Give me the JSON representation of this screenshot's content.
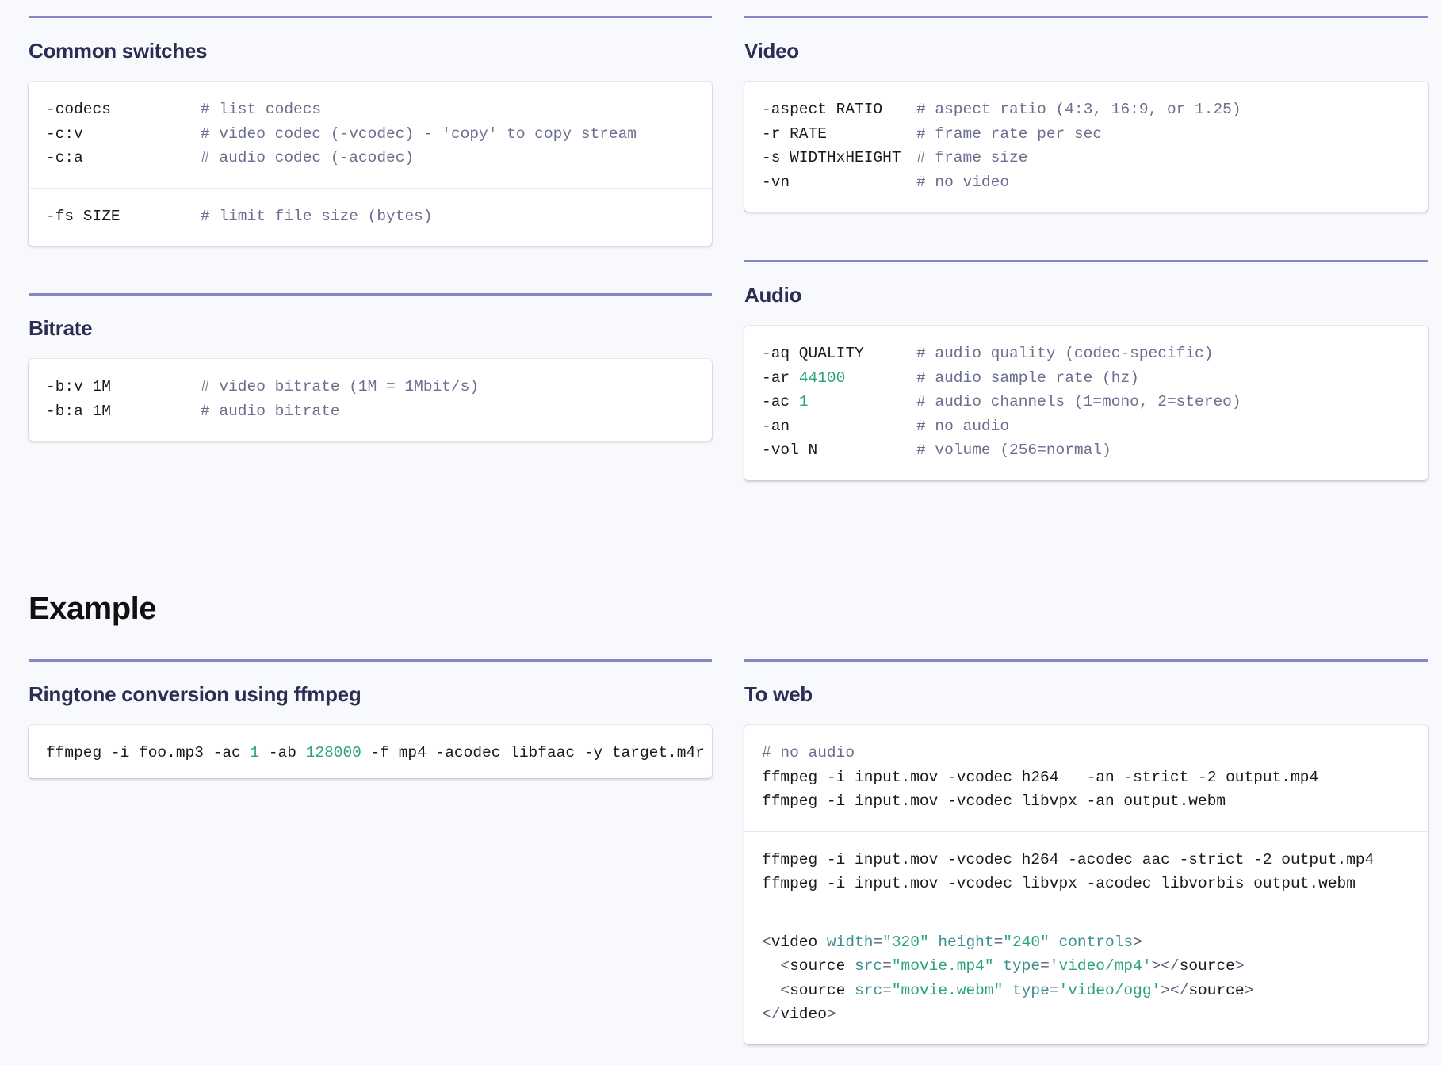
{
  "common_switches": {
    "title": "Common switches",
    "blocks": [
      [
        {
          "opt": "-codecs",
          "cmt": "# list codecs"
        },
        {
          "opt": "-c:v",
          "cmt": "# video codec (-vcodec) - 'copy' to copy stream"
        },
        {
          "opt": "-c:a",
          "cmt": "# audio codec (-acodec)"
        }
      ],
      [
        {
          "opt": "-fs SIZE",
          "cmt": "# limit file size (bytes)"
        }
      ]
    ]
  },
  "bitrate": {
    "title": "Bitrate",
    "lines": [
      {
        "opt": "-b:v 1M",
        "cmt": "# video bitrate (1M = 1Mbit/s)"
      },
      {
        "opt": "-b:a 1M",
        "cmt": "# audio bitrate"
      }
    ]
  },
  "video": {
    "title": "Video",
    "lines": [
      {
        "opt": "-aspect RATIO",
        "cmt": "# aspect ratio (4:3, 16:9, or 1.25)"
      },
      {
        "opt": "-r RATE",
        "cmt": "# frame rate per sec"
      },
      {
        "opt": "-s WIDTHxHEIGHT",
        "cmt": "# frame size"
      },
      {
        "opt": "-vn",
        "cmt": "# no video"
      }
    ]
  },
  "audio": {
    "title": "Audio",
    "lines": [
      {
        "opt": "-aq QUALITY",
        "num": "",
        "cmt": "# audio quality (codec-specific)"
      },
      {
        "opt": "-ar ",
        "num": "44100",
        "cmt": "# audio sample rate (hz)"
      },
      {
        "opt": "-ac ",
        "num": "1",
        "cmt": "# audio channels (1=mono, 2=stereo)"
      },
      {
        "opt": "-an",
        "num": "",
        "cmt": "# no audio"
      },
      {
        "opt": "-vol N",
        "num": "",
        "cmt": "# volume (256=normal)"
      }
    ]
  },
  "example": {
    "heading": "Example",
    "ringtone": {
      "title": "Ringtone conversion using ffmpeg",
      "parts": {
        "p1": "ffmpeg -i foo.mp3 -ac ",
        "n1": "1",
        "p2": " -ab ",
        "n2": "128000",
        "p3": " -f mp4 -acodec libfaac -y target.m4r"
      }
    },
    "to_web": {
      "title": "To web",
      "block1": {
        "comment": "# no audio",
        "lines": [
          "ffmpeg -i input.mov -vcodec h264   -an -strict -2 output.mp4",
          "ffmpeg -i input.mov -vcodec libvpx -an output.webm"
        ]
      },
      "block2": {
        "lines": [
          "ffmpeg -i input.mov -vcodec h264 -acodec aac -strict -2 output.mp4",
          "ffmpeg -i input.mov -vcodec libvpx -acodec libvorbis output.webm"
        ]
      },
      "block3": {
        "video_tag": "video",
        "width_attr": "width",
        "width_val": "\"320\"",
        "height_attr": "height",
        "height_val": "\"240\"",
        "controls": "controls",
        "source_tag": "source",
        "src_attr": "src",
        "src1": "\"movie.mp4\"",
        "type_attr": "type",
        "type1": "'video/mp4'",
        "src2": "\"movie.webm\"",
        "type2": "'video/ogg'"
      }
    }
  }
}
